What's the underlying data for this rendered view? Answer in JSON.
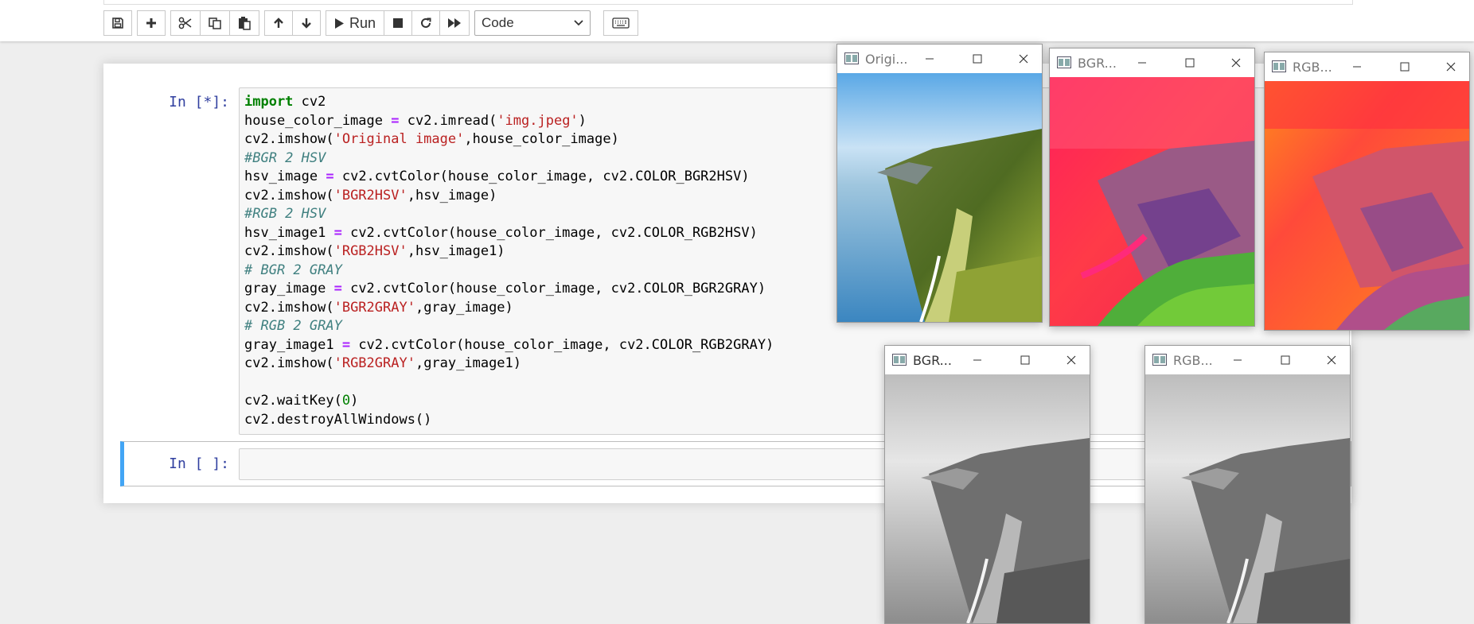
{
  "toolbar": {
    "run_label": "Run",
    "cell_type": "Code"
  },
  "cells": [
    {
      "prompt": "In [*]:",
      "code_lines": [
        "import cv2",
        "house_color_image = cv2.imread('img.jpeg')",
        "cv2.imshow('Original image',house_color_image)",
        "#BGR 2 HSV",
        "hsv_image = cv2.cvtColor(house_color_image, cv2.COLOR_BGR2HSV)",
        "cv2.imshow('BGR2HSV',hsv_image)",
        "#RGB 2 HSV",
        "hsv_image1 = cv2.cvtColor(house_color_image, cv2.COLOR_RGB2HSV)",
        "cv2.imshow('RGB2HSV',hsv_image1)",
        "# BGR 2 GRAY",
        "gray_image = cv2.cvtColor(house_color_image, cv2.COLOR_BGR2GRAY)",
        "cv2.imshow('BGR2GRAY',gray_image)",
        "# RGB 2 GRAY",
        "gray_image1 = cv2.cvtColor(house_color_image, cv2.COLOR_RGB2GRAY)",
        "cv2.imshow('RGB2GRAY',gray_image1)",
        "",
        "cv2.waitKey(0)",
        "cv2.destroyAllWindows()"
      ]
    },
    {
      "prompt": "In [ ]:",
      "code_lines": [
        ""
      ]
    }
  ],
  "windows": [
    {
      "title": "Origi...",
      "image": "coastal cliff photo (color)"
    },
    {
      "title": "BGR...",
      "image": "coastal cliff photo (BGR2HSV false color)"
    },
    {
      "title": "RGB...",
      "image": "coastal cliff photo (RGB2HSV false color)"
    },
    {
      "title": "BGR...",
      "image": "coastal cliff photo (BGR2GRAY grayscale)"
    },
    {
      "title": "RGB...",
      "image": "coastal cliff photo (RGB2GRAY grayscale)"
    }
  ],
  "colors": {
    "prompt": "#303f9f",
    "keyword": "#008000",
    "string": "#ba2121",
    "comment": "#408080",
    "operator": "#aa22ff",
    "cell_selected": "#42a5f5"
  }
}
